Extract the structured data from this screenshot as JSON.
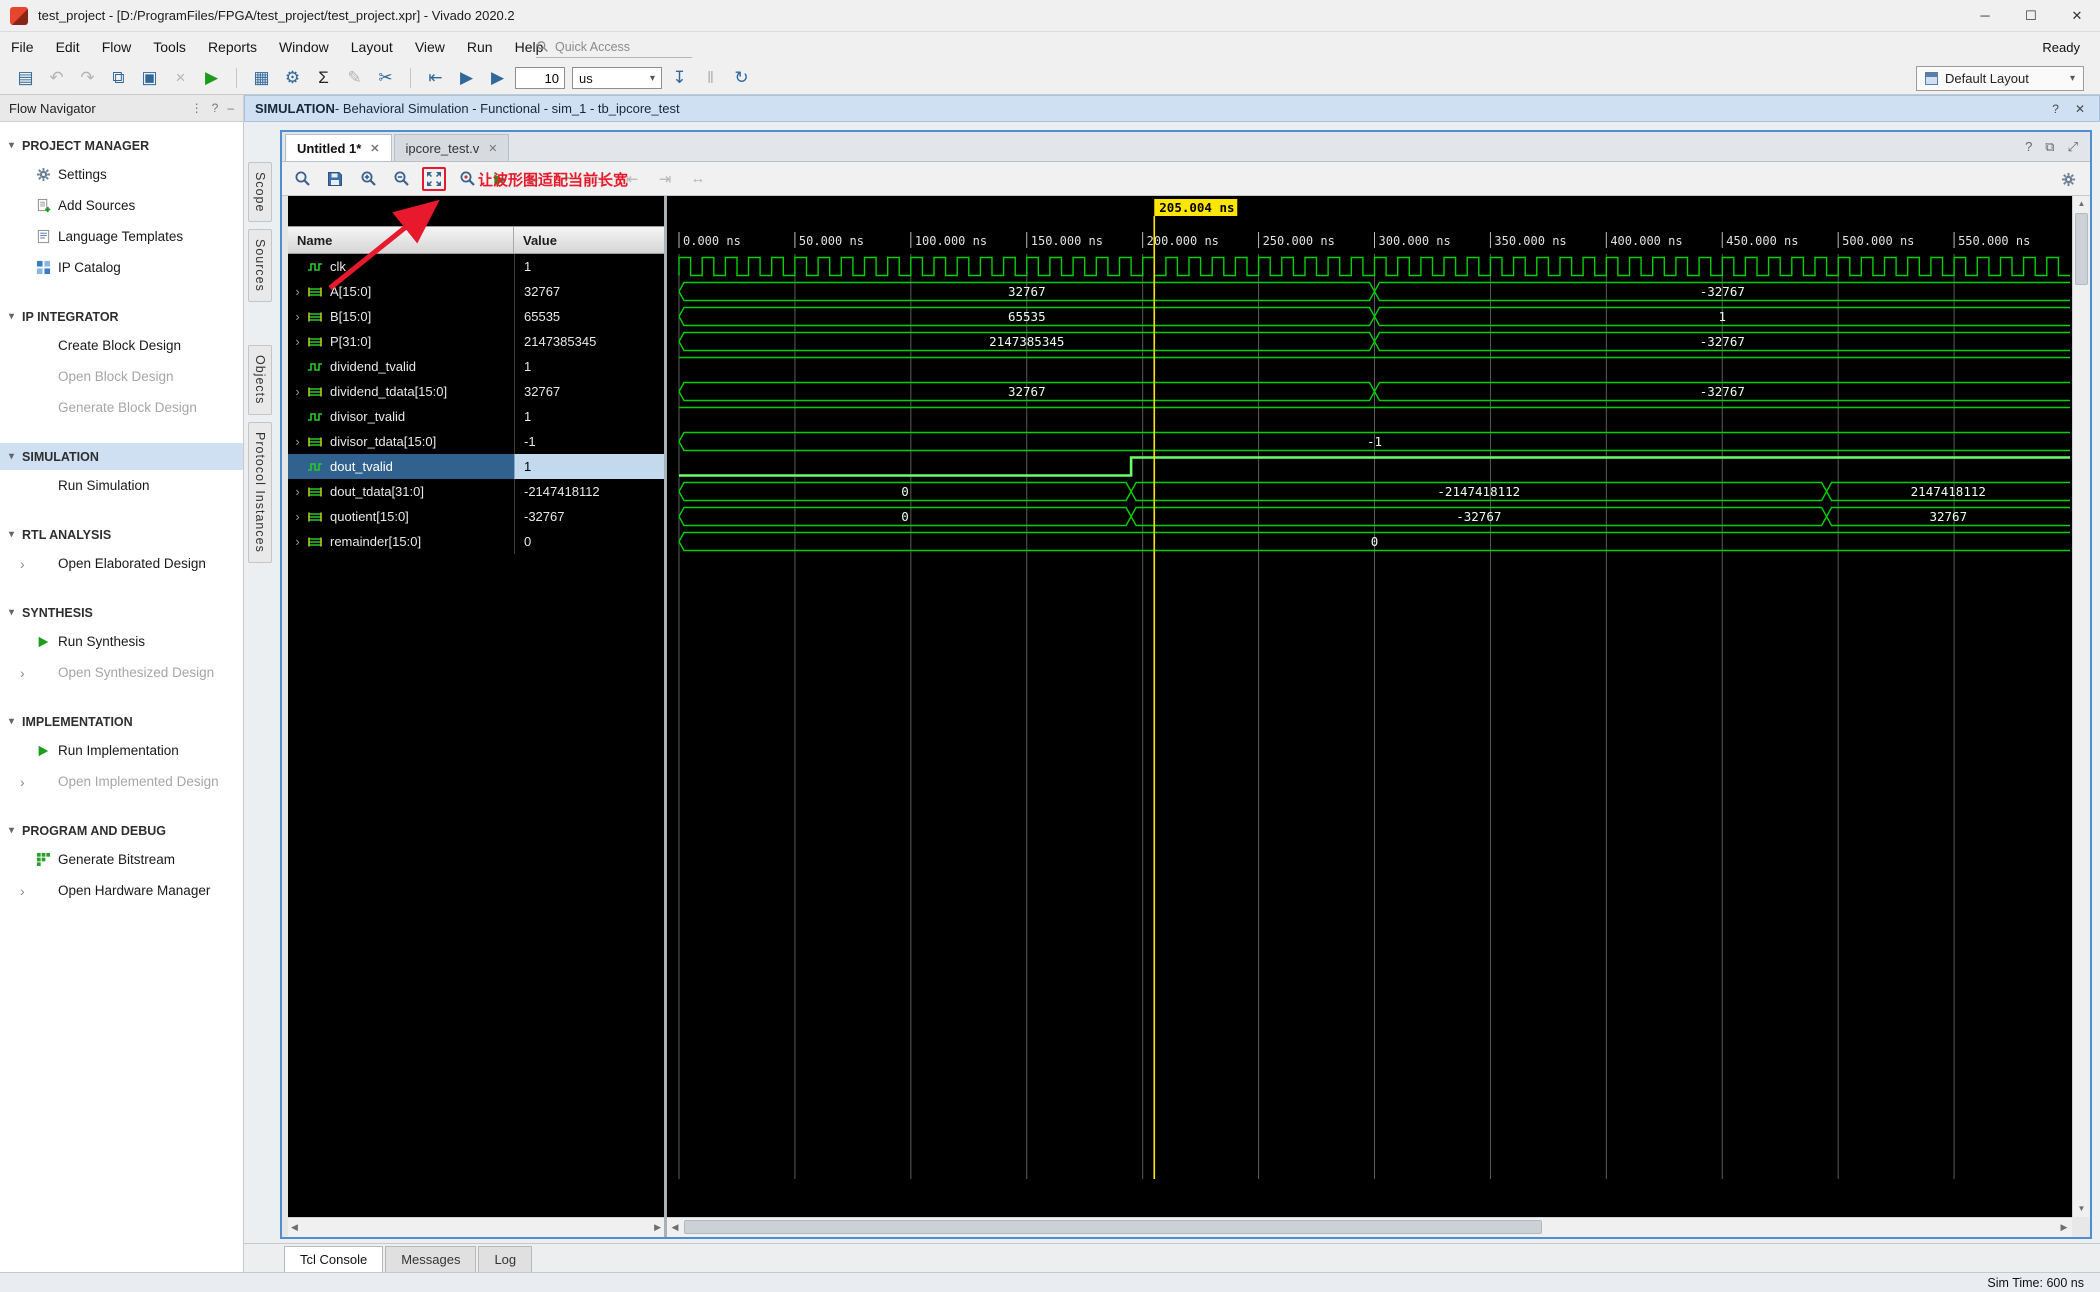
{
  "titlebar": {
    "title": "test_project - [D:/ProgramFiles/FPGA/test_project/test_project.xpr] - Vivado 2020.2",
    "status": "Ready",
    "window_buttons": [
      {
        "name": "minimize-button",
        "glyph": "─"
      },
      {
        "name": "maximize-button",
        "glyph": "☐"
      },
      {
        "name": "close-button",
        "glyph": "✕"
      }
    ]
  },
  "menubar": {
    "items": [
      "File",
      "Edit",
      "Flow",
      "Tools",
      "Reports",
      "Window",
      "Layout",
      "View",
      "Run",
      "Help"
    ],
    "quick_access": "Quick Access"
  },
  "main_toolbar": {
    "run_time_value": "10",
    "run_time_unit": "us",
    "layout_selector": "Default Layout",
    "icons": [
      {
        "name": "open-file-icon",
        "glyph": "▤"
      },
      {
        "name": "undo-icon",
        "glyph": "↶",
        "disabled": true
      },
      {
        "name": "redo-icon",
        "glyph": "↷",
        "disabled": true
      },
      {
        "name": "copy-icon",
        "glyph": "⧉"
      },
      {
        "name": "paste-icon",
        "glyph": "▣"
      },
      {
        "name": "delete-icon",
        "glyph": "×",
        "disabled": true
      },
      {
        "name": "run-flow-icon",
        "glyph": "▶",
        "color": "#1c9c1c"
      },
      {
        "name": "separator"
      },
      {
        "name": "report-strategy-icon",
        "glyph": "▦",
        "color": "#31689a"
      },
      {
        "name": "settings-gear-icon",
        "glyph": "⚙",
        "color": "#31689a"
      },
      {
        "name": "sum-icon",
        "glyph": "Σ",
        "color": "#222222"
      },
      {
        "name": "edit-icon",
        "glyph": "✎",
        "disabled": true
      },
      {
        "name": "probe-icon",
        "glyph": "✂",
        "color": "#31689a"
      },
      {
        "name": "separator"
      },
      {
        "name": "restart-simulation-icon",
        "glyph": "⇤",
        "color": "#31689a"
      },
      {
        "name": "run-all-icon",
        "glyph": "▶",
        "color": "#31689a"
      },
      {
        "name": "run-for-time-icon",
        "glyph": "▶",
        "color": "#31689a"
      }
    ],
    "right_icons": [
      {
        "name": "step-icon",
        "glyph": "↧",
        "color": "#31689a"
      },
      {
        "name": "pause-icon",
        "glyph": "‖",
        "disabled": true
      },
      {
        "name": "relaunch-icon",
        "glyph": "↻",
        "color": "#31689a"
      }
    ]
  },
  "context_bar": {
    "title_strong": "SIMULATION",
    "title_rest": " - Behavioral Simulation - Functional - sim_1 - tb_ipcore_test",
    "right_icons": [
      "?",
      "✕"
    ]
  },
  "flow_navigator": {
    "title": "Flow Navigator",
    "sections": [
      {
        "label": "PROJECT MANAGER",
        "items": [
          {
            "label": "Settings",
            "icon": "gear"
          },
          {
            "label": "Add Sources",
            "icon": "add-sources"
          },
          {
            "label": "Language Templates",
            "icon": "language-templates"
          },
          {
            "label": "IP Catalog",
            "icon": "ip-catalog"
          }
        ]
      },
      {
        "label": "IP INTEGRATOR",
        "items": [
          {
            "label": "Create Block Design"
          },
          {
            "label": "Open Block Design",
            "disabled": true
          },
          {
            "label": "Generate Block Design",
            "disabled": true
          }
        ]
      },
      {
        "label": "SIMULATION",
        "selected": true,
        "items": [
          {
            "label": "Run Simulation"
          }
        ]
      },
      {
        "label": "RTL ANALYSIS",
        "items": [
          {
            "label": "Open Elaborated Design",
            "expandable": true
          }
        ]
      },
      {
        "label": "SYNTHESIS",
        "items": [
          {
            "label": "Run Synthesis",
            "icon": "run"
          },
          {
            "label": "Open Synthesized Design",
            "disabled": true,
            "expandable": true
          }
        ]
      },
      {
        "label": "IMPLEMENTATION",
        "items": [
          {
            "label": "Run Implementation",
            "icon": "run"
          },
          {
            "label": "Open Implemented Design",
            "disabled": true,
            "expandable": true
          }
        ]
      },
      {
        "label": "PROGRAM AND DEBUG",
        "items": [
          {
            "label": "Generate Bitstream",
            "icon": "bitstream"
          },
          {
            "label": "Open Hardware Manager",
            "expandable": true
          }
        ]
      }
    ]
  },
  "editor": {
    "tabs": [
      {
        "label": "Untitled 1*",
        "active": true
      },
      {
        "label": "ipcore_test.v",
        "active": false
      }
    ],
    "tab_right_icons": [
      "?",
      "⧉",
      "⤢"
    ],
    "side_tab_groups": [
      [
        "Scope",
        "Sources"
      ],
      [
        "Objects",
        "Protocol Instances"
      ]
    ],
    "annotation": "让波形图适配当前长宽",
    "table": {
      "name_header": "Name",
      "value_header": "Value"
    }
  },
  "wave_toolbar": {
    "icons": [
      {
        "name": "find-icon",
        "icon": "search"
      },
      {
        "name": "save-waveform-icon",
        "icon": "floppy"
      },
      {
        "name": "zoom-in-icon",
        "icon": "zoomin"
      },
      {
        "name": "zoom-out-icon",
        "icon": "zoomout"
      },
      {
        "name": "zoom-fit-icon",
        "icon": "zoomfit",
        "highlight": true
      },
      {
        "name": "zoom-to-cursor-icon",
        "icon": "zoomcursor"
      },
      {
        "name": "play-from-cursor-icon",
        "glyph": "▶",
        "color": "#1c9c1c"
      },
      {
        "name": "next-transition-icon",
        "glyph": "▶",
        "disabled": true
      },
      {
        "name": "add-signal-icon",
        "glyph": "+",
        "color": "#1c9c1c"
      },
      {
        "name": "insert-divider-icon",
        "glyph": "▭",
        "disabled": true
      },
      {
        "name": "goto-start-icon",
        "glyph": "⇤",
        "disabled": true
      },
      {
        "name": "goto-end-icon",
        "glyph": "⇥",
        "disabled": true
      },
      {
        "name": "swap-cursor-icon",
        "glyph": "↔",
        "disabled": true
      }
    ]
  },
  "wave": {
    "time_unit": "ns",
    "time_start": 0,
    "time_end": 600,
    "tick_step": 50,
    "ticks": [
      "0.000 ns",
      "50.000 ns",
      "100.000 ns",
      "150.000 ns",
      "200.000 ns",
      "250.000 ns",
      "300.000 ns",
      "350.000 ns",
      "400.000 ns",
      "450.000 ns",
      "500.000 ns",
      "550.000 ns"
    ],
    "cursor_time": 205.004,
    "cursor_label": "205.004 ns",
    "signals": [
      {
        "name": "clk",
        "value": "1",
        "kind": "clock",
        "period": 10
      },
      {
        "name": "A[15:0]",
        "value": "32767",
        "kind": "bus",
        "segments": [
          [
            0,
            300,
            "32767"
          ],
          [
            300,
            600,
            "-32767"
          ]
        ]
      },
      {
        "name": "B[15:0]",
        "value": "65535",
        "kind": "bus",
        "segments": [
          [
            0,
            300,
            "65535"
          ],
          [
            300,
            600,
            "1"
          ]
        ]
      },
      {
        "name": "P[31:0]",
        "value": "2147385345",
        "kind": "bus",
        "segments": [
          [
            0,
            300,
            "2147385345"
          ],
          [
            300,
            600,
            "-32767"
          ]
        ]
      },
      {
        "name": "dividend_tvalid",
        "value": "1",
        "kind": "scalar",
        "levels": [
          [
            0,
            600,
            1
          ]
        ]
      },
      {
        "name": "dividend_tdata[15:0]",
        "value": "32767",
        "kind": "bus",
        "segments": [
          [
            0,
            300,
            "32767"
          ],
          [
            300,
            600,
            "-32767"
          ]
        ]
      },
      {
        "name": "divisor_tvalid",
        "value": "1",
        "kind": "scalar",
        "levels": [
          [
            0,
            600,
            1
          ]
        ]
      },
      {
        "name": "divisor_tdata[15:0]",
        "value": "-1",
        "kind": "bus",
        "segments": [
          [
            0,
            600,
            "-1"
          ]
        ]
      },
      {
        "name": "dout_tvalid",
        "value": "1",
        "kind": "scalar",
        "selected": true,
        "levels": [
          [
            0,
            195,
            0
          ],
          [
            195,
            600,
            1
          ]
        ]
      },
      {
        "name": "dout_tdata[31:0]",
        "value": "-2147418112",
        "kind": "bus",
        "segments": [
          [
            0,
            195,
            "0"
          ],
          [
            195,
            495,
            "-2147418112"
          ],
          [
            495,
            600,
            "2147418112"
          ]
        ]
      },
      {
        "name": "quotient[15:0]",
        "value": "-32767",
        "kind": "bus",
        "segments": [
          [
            0,
            195,
            "0"
          ],
          [
            195,
            495,
            "-32767"
          ],
          [
            495,
            600,
            "32767"
          ]
        ]
      },
      {
        "name": "remainder[15:0]",
        "value": "0",
        "kind": "bus",
        "segments": [
          [
            0,
            600,
            "0"
          ]
        ]
      }
    ]
  },
  "console": {
    "tabs": [
      {
        "label": "Tcl Console",
        "active": true
      },
      {
        "label": "Messages",
        "active": false
      },
      {
        "label": "Log",
        "active": false
      }
    ]
  },
  "statusbar": {
    "sim_time": "Sim Time: 600 ns"
  }
}
